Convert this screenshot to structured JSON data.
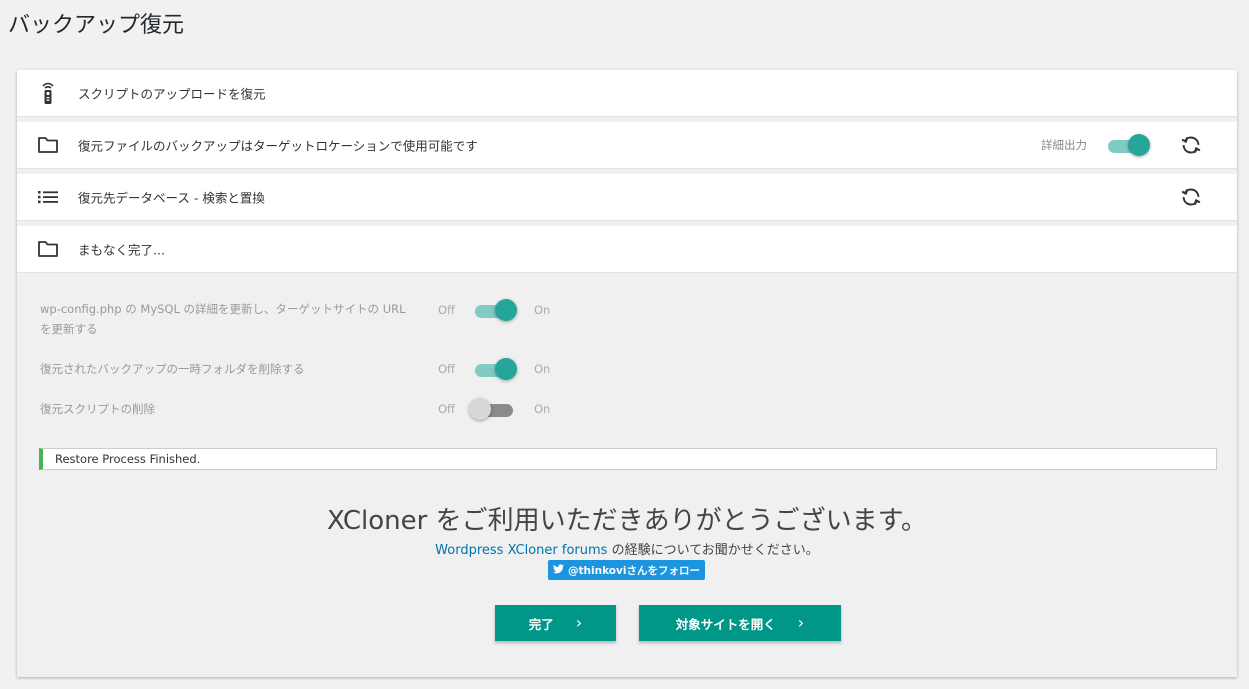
{
  "page": {
    "title": "バックアップ復元"
  },
  "steps": [
    {
      "label": "スクリプトのアップロードを復元",
      "icon": "remote-icon"
    },
    {
      "label": "復元ファイルのバックアップはターゲットロケーションで使用可能です",
      "icon": "folder-icon",
      "verbose_label": "詳細出力",
      "verbose_on": true
    },
    {
      "label": "復元先データベース - 検索と置換",
      "icon": "list-icon"
    },
    {
      "label": "まもなく完了...",
      "icon": "folder-icon"
    }
  ],
  "options": [
    {
      "label": "wp-config.php の MySQL の詳細を更新し、ターゲットサイトの URL を更新する",
      "off": "Off",
      "on": "On",
      "checked": true
    },
    {
      "label": "復元されたバックアップの一時フォルダを削除する",
      "off": "Off",
      "on": "On",
      "checked": true
    },
    {
      "label": "復元スクリプトの削除",
      "off": "Off",
      "on": "On",
      "checked": false
    }
  ],
  "status": {
    "message": "Restore Process Finished."
  },
  "thanks": {
    "title": "XCloner をご利用いただきありがとうございます。",
    "forum_link": "Wordpress XCloner forums",
    "forum_suffix": " の経験についてお聞かせください。",
    "twitter_label": "@thinkoviさんをフォロー"
  },
  "buttons": {
    "done": "完了",
    "open_site": "対象サイトを開く",
    "chevron": "›"
  },
  "colors": {
    "accent": "#009688",
    "toggle_on": "#26a69a",
    "success": "#46b450",
    "link": "#0073aa",
    "twitter": "#1b95e0"
  }
}
